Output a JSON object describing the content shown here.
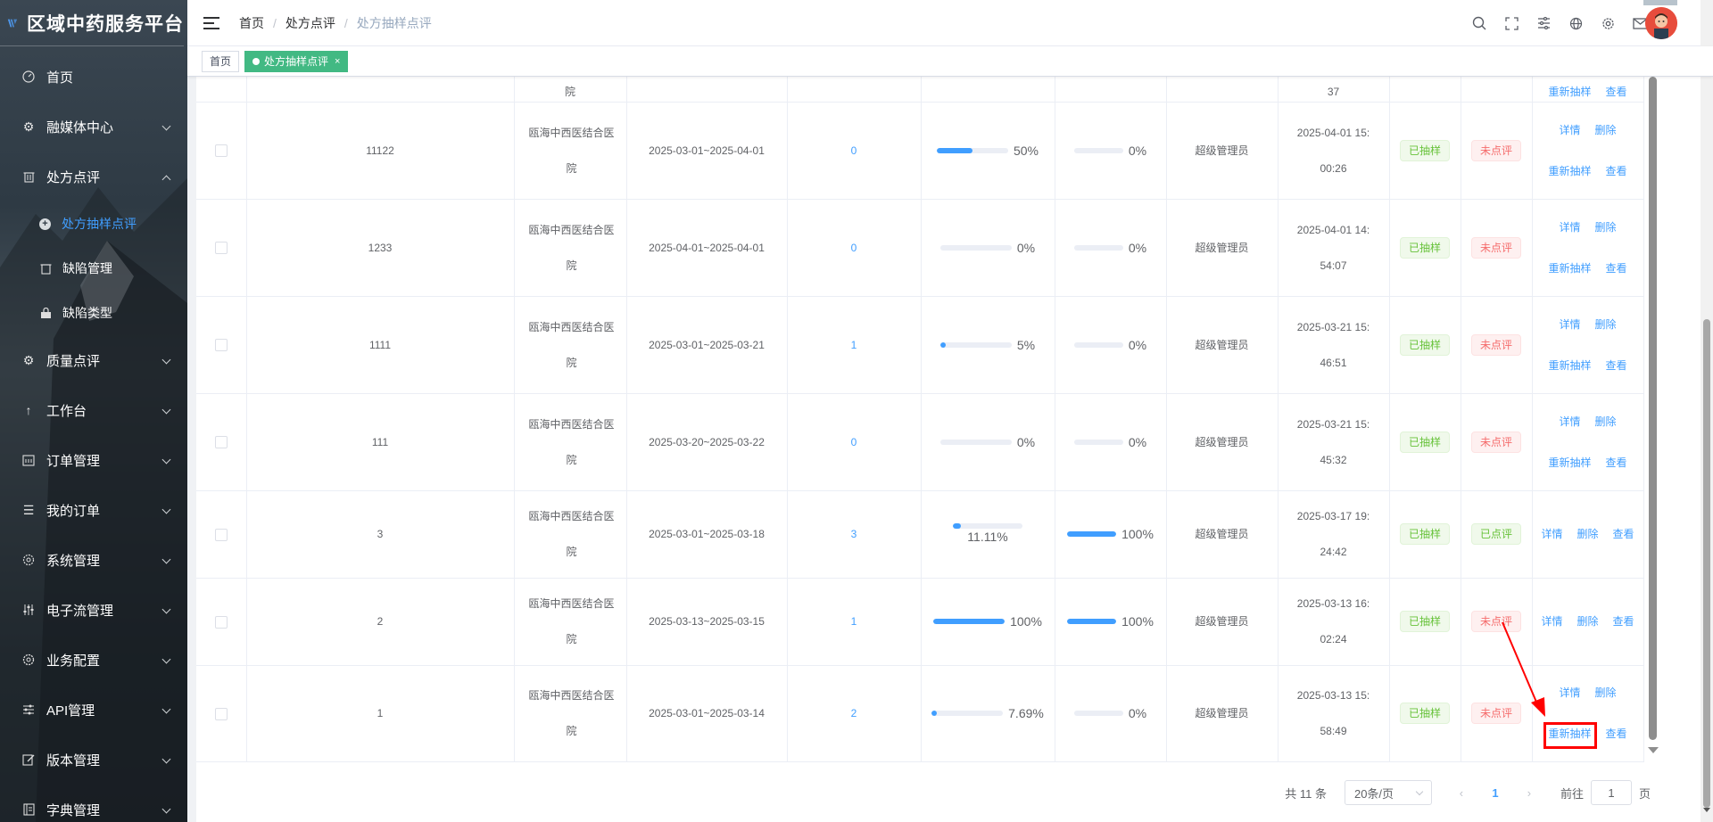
{
  "app": {
    "title": "区域中药服务平台"
  },
  "sidebar": {
    "items": [
      {
        "label": "首页",
        "icon": "dashboard-icon",
        "expandable": false
      },
      {
        "label": "融媒体中心",
        "icon": "gear-icon",
        "expandable": true
      },
      {
        "label": "处方点评",
        "icon": "trash-icon",
        "expandable": true,
        "expanded": true,
        "children": [
          {
            "label": "处方抽样点评",
            "icon": "plus-circle-icon",
            "active": true
          },
          {
            "label": "缺陷管理",
            "icon": "trash-icon"
          },
          {
            "label": "缺陷类型",
            "icon": "bag-icon"
          }
        ]
      },
      {
        "label": "质量点评",
        "icon": "gear-icon",
        "expandable": true
      },
      {
        "label": "工作台",
        "icon": "arrow-up-icon",
        "expandable": true
      },
      {
        "label": "订单管理",
        "icon": "calendar-icon",
        "expandable": true
      },
      {
        "label": "我的订单",
        "icon": "list-icon",
        "expandable": true
      },
      {
        "label": "系统管理",
        "icon": "system-icon",
        "expandable": true
      },
      {
        "label": "电子流管理",
        "icon": "sliders-icon",
        "expandable": true
      },
      {
        "label": "业务配置",
        "icon": "cog-icon",
        "expandable": true
      },
      {
        "label": "API管理",
        "icon": "filter-icon",
        "expandable": true
      },
      {
        "label": "版本管理",
        "icon": "edit-icon",
        "expandable": true
      },
      {
        "label": "字典管理",
        "icon": "book-icon",
        "expandable": true
      }
    ]
  },
  "header": {
    "breadcrumb": [
      "首页",
      "处方点评",
      "处方抽样点评"
    ],
    "icons": [
      "search-icon",
      "fullscreen-icon",
      "settings-sliders-icon",
      "globe-icon",
      "gear-icon",
      "mail-icon"
    ]
  },
  "tags": {
    "home": "首页",
    "active": "处方抽样点评",
    "close": "×"
  },
  "table": {
    "partial_top": {
      "hospital_tail": "院",
      "time_tail": "37",
      "ops": [
        "重新抽样",
        "查看"
      ]
    },
    "rows": [
      {
        "name": "11122",
        "hospital": "瓯海中西医结合医院",
        "period": "2025-03-01~2025-04-01",
        "count": "0",
        "progress1": 50,
        "progress1_label": "50%",
        "progress2": 0,
        "progress2_label": "0%",
        "operator": "超级管理员",
        "time": "2025-04-01 15:00:26",
        "sample_status": "已抽样",
        "review_status": "未点评",
        "review_color": "red",
        "ops": [
          "详情",
          "删除",
          "重新抽样",
          "查看"
        ]
      },
      {
        "name": "1233",
        "hospital": "瓯海中西医结合医院",
        "period": "2025-04-01~2025-04-01",
        "count": "0",
        "progress1": 0,
        "progress1_label": "0%",
        "progress2": 0,
        "progress2_label": "0%",
        "operator": "超级管理员",
        "time": "2025-04-01 14:54:07",
        "sample_status": "已抽样",
        "review_status": "未点评",
        "review_color": "red",
        "ops": [
          "详情",
          "删除",
          "重新抽样",
          "查看"
        ]
      },
      {
        "name": "1111",
        "hospital": "瓯海中西医结合医院",
        "period": "2025-03-01~2025-03-21",
        "count": "1",
        "progress1": 5,
        "progress1_label": "5%",
        "progress2": 0,
        "progress2_label": "0%",
        "operator": "超级管理员",
        "time": "2025-03-21 15:46:51",
        "sample_status": "已抽样",
        "review_status": "未点评",
        "review_color": "red",
        "ops": [
          "详情",
          "删除",
          "重新抽样",
          "查看"
        ]
      },
      {
        "name": "111",
        "hospital": "瓯海中西医结合医院",
        "period": "2025-03-20~2025-03-22",
        "count": "0",
        "progress1": 0,
        "progress1_label": "0%",
        "progress2": 0,
        "progress2_label": "0%",
        "operator": "超级管理员",
        "time": "2025-03-21 15:45:32",
        "sample_status": "已抽样",
        "review_status": "未点评",
        "review_color": "red",
        "ops": [
          "详情",
          "删除",
          "重新抽样",
          "查看"
        ]
      },
      {
        "name": "3",
        "hospital": "瓯海中西医结合医院",
        "period": "2025-03-01~2025-03-18",
        "count": "3",
        "progress1": 11.11,
        "progress1_label": "11.11%",
        "progress2": 100,
        "progress2_label": "100%",
        "operator": "超级管理员",
        "time": "2025-03-17 19:24:42",
        "sample_status": "已抽样",
        "review_status": "已点评",
        "review_color": "green",
        "ops": [
          "详情",
          "删除",
          "查看"
        ]
      },
      {
        "name": "2",
        "hospital": "瓯海中西医结合医院",
        "period": "2025-03-13~2025-03-15",
        "count": "1",
        "progress1": 100,
        "progress1_label": "100%",
        "progress2": 100,
        "progress2_label": "100%",
        "operator": "超级管理员",
        "time": "2025-03-13 16:02:24",
        "sample_status": "已抽样",
        "review_status": "未点评",
        "review_color": "red",
        "ops": [
          "详情",
          "删除",
          "查看"
        ]
      },
      {
        "name": "1",
        "hospital": "瓯海中西医结合医院",
        "period": "2025-03-01~2025-03-14",
        "count": "2",
        "progress1": 7.69,
        "progress1_label": "7.69%",
        "progress2": 0,
        "progress2_label": "0%",
        "operator": "超级管理员",
        "time": "2025-03-13 15:58:49",
        "sample_status": "已抽样",
        "review_status": "未点评",
        "review_color": "red",
        "ops": [
          "详情",
          "删除",
          "重新抽样",
          "查看"
        ]
      }
    ]
  },
  "pagination": {
    "total": "共 11 条",
    "page_size": "20条/页",
    "current": "1",
    "goto_prefix": "前往",
    "goto_value": "1",
    "goto_suffix": "页"
  },
  "colors": {
    "primary": "#409eff",
    "tag_active": "#42b983",
    "success": "#67c23a",
    "danger": "#f56c6c",
    "annotation": "#ff0000"
  }
}
